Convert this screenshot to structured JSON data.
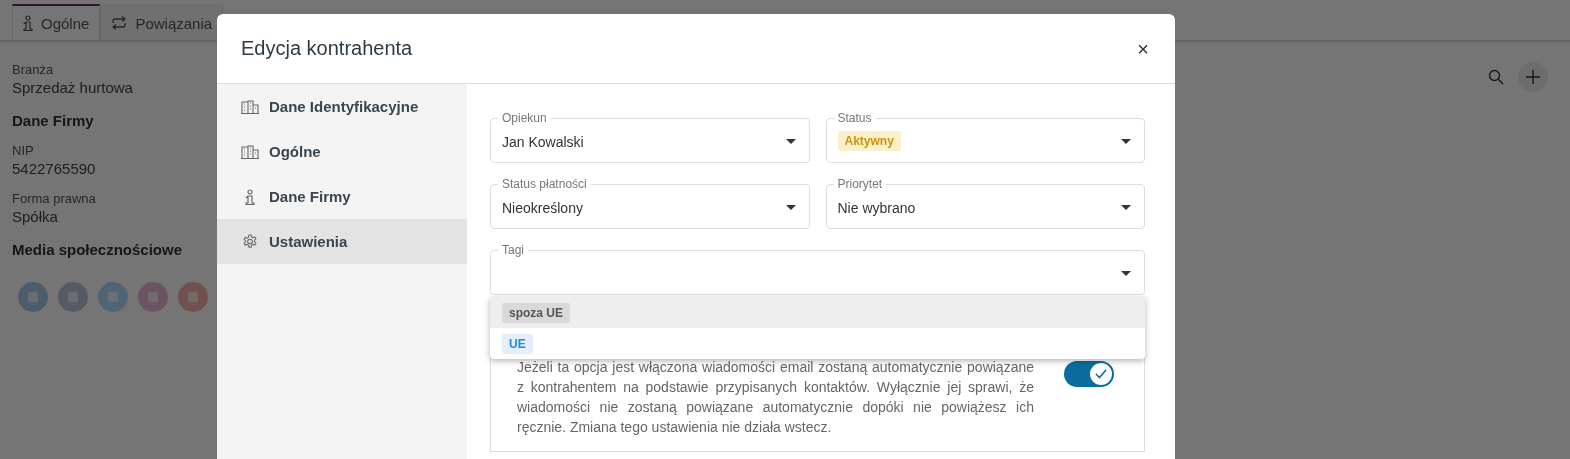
{
  "background": {
    "tabs": [
      {
        "label": "Ogólne",
        "selected": true
      },
      {
        "label": "Powiązania",
        "selected": false
      }
    ],
    "info": [
      {
        "kind": "field",
        "label": "Branża",
        "value": "Sprzedaż hurtowa"
      },
      {
        "kind": "heading",
        "label": "Dane Firmy"
      },
      {
        "kind": "field",
        "label": "NIP",
        "value": "5422765590"
      },
      {
        "kind": "field",
        "label": "Forma prawna",
        "value": "Spółka"
      },
      {
        "kind": "heading",
        "label": "Media społecznościowe"
      }
    ]
  },
  "modal": {
    "title": "Edycja kontrahenta",
    "close": "×",
    "nav": [
      {
        "label": "Dane Identyfikacyjne",
        "selected": false
      },
      {
        "label": "Ogólne",
        "selected": false
      },
      {
        "label": "Dane Firmy",
        "selected": false
      },
      {
        "label": "Ustawienia",
        "selected": true
      }
    ],
    "fields": [
      {
        "label": "Opiekun",
        "kind": "text",
        "value": "Jan Kowalski"
      },
      {
        "label": "Status",
        "kind": "badge",
        "value": "Aktywny"
      },
      {
        "label": "Status płatności",
        "kind": "text",
        "value": "Nieokreślony"
      },
      {
        "label": "Priorytet",
        "kind": "text",
        "value": "Nie wybrano"
      }
    ],
    "tags": {
      "label": "Tagi",
      "options": [
        {
          "label": "spoza UE",
          "color": "#555555",
          "highlighted": true
        },
        {
          "label": "UE",
          "color": "#2b88d8",
          "highlighted": false
        }
      ]
    },
    "setting": {
      "description": "Jeżeli ta opcja jest włączona wiadomości email zostaną automatycznie powiązane z kontrahentem na podstawie przypisanych kontaktów. Wyłącznie jej sprawi, że wiadomości nie zostaną powiązane automatycznie dopóki nie powiążesz ich ręcznie. Zmiana tego ustawienia nie działa wstecz.",
      "on": true
    }
  }
}
